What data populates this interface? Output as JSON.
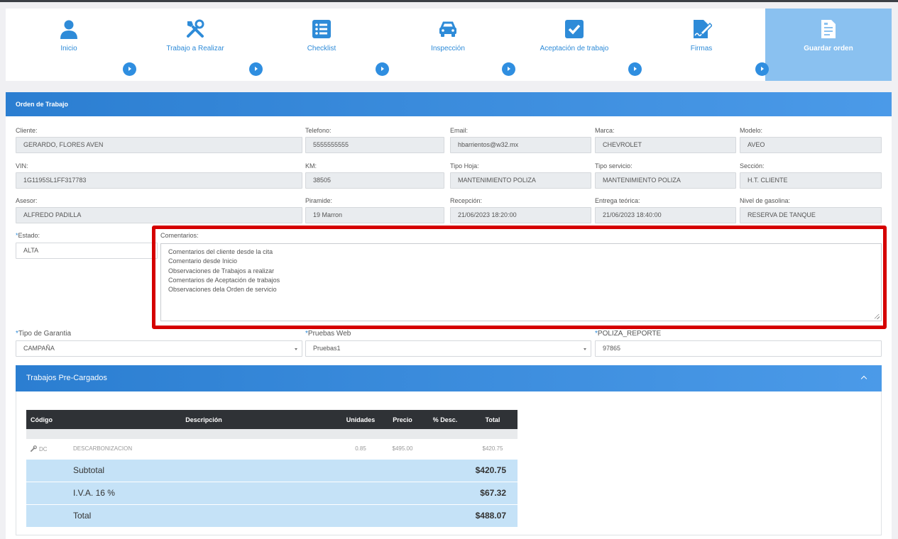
{
  "wizard": {
    "steps": [
      {
        "label": "Inicio",
        "icon": "user-icon"
      },
      {
        "label": "Trabajo a Realizar",
        "icon": "tools-icon"
      },
      {
        "label": "Checklist",
        "icon": "checklist-icon"
      },
      {
        "label": "Inspección",
        "icon": "car-icon"
      },
      {
        "label": "Aceptación de trabajo",
        "icon": "checkbox-icon"
      },
      {
        "label": "Firmas",
        "icon": "signature-icon"
      },
      {
        "label": "Guardar orden",
        "icon": "save-document-icon"
      }
    ]
  },
  "order": {
    "title": "Orden de Trabajo",
    "fields": {
      "cliente": {
        "label": "Cliente:",
        "value": "GERARDO, FLORES AVEN"
      },
      "telefono": {
        "label": "Telefono:",
        "value": "5555555555"
      },
      "email": {
        "label": "Email:",
        "value": "hbarrientos@w32.mx"
      },
      "marca": {
        "label": "Marca:",
        "value": "CHEVROLET"
      },
      "modelo": {
        "label": "Modelo:",
        "value": "AVEO"
      },
      "vin": {
        "label": "VIN:",
        "value": "1G1195SL1FF317783"
      },
      "km": {
        "label": "KM:",
        "value": "38505"
      },
      "tipo_hoja": {
        "label": "Tipo Hoja:",
        "value": "MANTENIMIENTO POLIZA"
      },
      "tipo_servicio": {
        "label": "Tipo servicio:",
        "value": "MANTENIMIENTO POLIZA"
      },
      "seccion": {
        "label": "Sección:",
        "value": "H.T. CLIENTE"
      },
      "asesor": {
        "label": "Asesor:",
        "value": "ALFREDO PADILLA"
      },
      "piramide": {
        "label": "Piramide:",
        "value": "19 Marron"
      },
      "recepcion": {
        "label": "Recepción:",
        "value": "21/06/2023 18:20:00"
      },
      "entrega": {
        "label": "Entrega teórica:",
        "value": "21/06/2023 18:40:00"
      },
      "gasolina": {
        "label": "Nivel de gasolina:",
        "value": "RESERVA DE TANQUE"
      },
      "estado": {
        "label": "Estado:",
        "value": "ALTA"
      },
      "tipo_garantia": {
        "label": "Tipo de Garantia",
        "value": "CAMPAÑA"
      },
      "pruebas_web": {
        "label": "Pruebas Web",
        "value": "Pruebas1"
      },
      "poliza_reporte": {
        "label": "POLIZA_REPORTE",
        "value": "97865"
      }
    },
    "required_mark": "*",
    "comentarios": {
      "label": "Comentarios:",
      "lines": [
        "Comentarios del cliente desde la cita",
        "Comentario desde Inicio",
        "Observaciones de Trabajos a realizar",
        "Comentarios de Aceptación de trabajos",
        "Observaciones dela Orden de servicio"
      ]
    }
  },
  "jobs_panel": {
    "title": "Trabajos Pre-Cargados",
    "columns": [
      "Código",
      "Descripción",
      "Unidades",
      "Precio",
      "% Desc.",
      "Total"
    ],
    "rows": [
      {
        "codigo": "DC",
        "descripcion": "DESCARBONIZACION",
        "unidades": "0.85",
        "precio": "$495.00",
        "desc": "",
        "total": "$420.75"
      }
    ],
    "summary": {
      "subtotal_label": "Subtotal",
      "subtotal": "$420.75",
      "iva_label": "I.V.A. 16 %",
      "iva": "$67.32",
      "total_label": "Total",
      "total": "$488.07"
    }
  },
  "colors": {
    "accent": "#2e8bd8",
    "highlight": "#d50000",
    "active_step": "#8ac1f0"
  }
}
